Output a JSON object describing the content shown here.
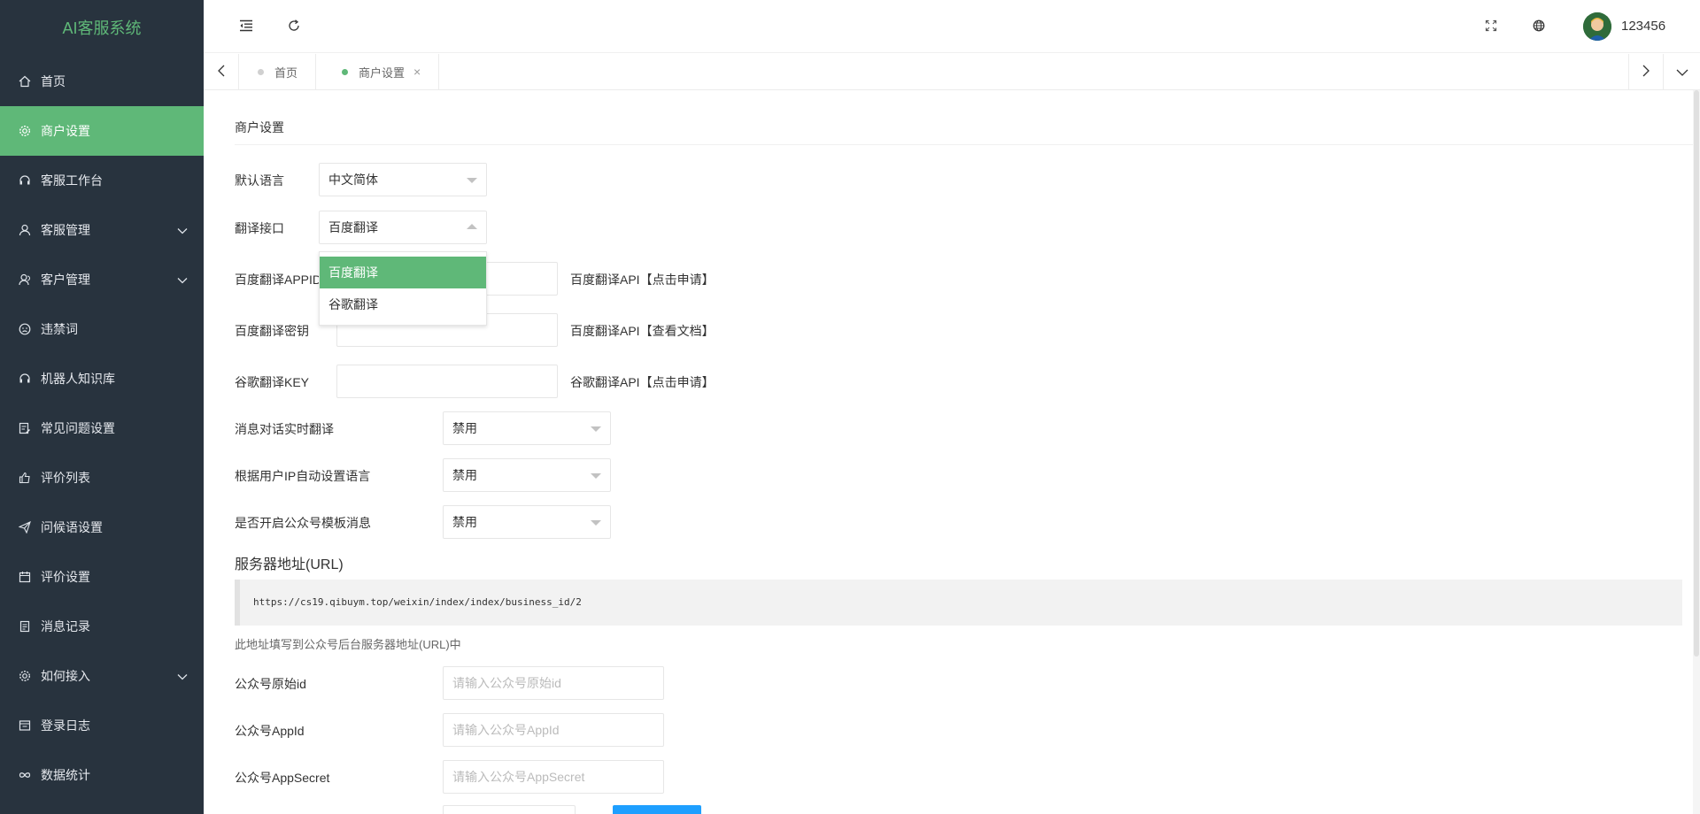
{
  "app": {
    "title": "AI客服系统"
  },
  "sidebar": {
    "items": [
      {
        "label": "首页",
        "icon": "home-icon"
      },
      {
        "label": "商户设置",
        "icon": "gear-icon",
        "active": true
      },
      {
        "label": "客服工作台",
        "icon": "headset-icon"
      },
      {
        "label": "客服管理",
        "icon": "user-icon",
        "expandable": true
      },
      {
        "label": "客户管理",
        "icon": "users-icon",
        "expandable": true
      },
      {
        "label": "违禁词",
        "icon": "face-icon"
      },
      {
        "label": "机器人知识库",
        "icon": "robot-icon"
      },
      {
        "label": "常见问题设置",
        "icon": "edit-doc-icon"
      },
      {
        "label": "评价列表",
        "icon": "thumb-up-icon"
      },
      {
        "label": "问候语设置",
        "icon": "send-icon"
      },
      {
        "label": "评价设置",
        "icon": "calendar-icon"
      },
      {
        "label": "消息记录",
        "icon": "doc-icon"
      },
      {
        "label": "如何接入",
        "icon": "settings-icon",
        "expandable": true
      },
      {
        "label": "登录日志",
        "icon": "log-icon"
      },
      {
        "label": "数据统计",
        "icon": "infinity-icon"
      }
    ]
  },
  "header": {
    "username": "123456"
  },
  "tabs": [
    {
      "label": "首页",
      "active": false
    },
    {
      "label": "商户设置",
      "active": true,
      "closable": true
    }
  ],
  "form": {
    "card_title": "商户设置",
    "default_language": {
      "label": "默认语言",
      "value": "中文简体"
    },
    "translate_api": {
      "label": "翻译接口",
      "value": "百度翻译",
      "options": [
        "百度翻译",
        "谷歌翻译"
      ],
      "open": true
    },
    "baidu_appid": {
      "label": "百度翻译APPID",
      "value": "",
      "link": "百度翻译API【点击申请】"
    },
    "baidu_secret": {
      "label": "百度翻译密钥",
      "value": "",
      "link": "百度翻译API【查看文档】"
    },
    "google_key": {
      "label": "谷歌翻译KEY",
      "value": "",
      "link": "谷歌翻译API【点击申请】"
    },
    "realtime_translate": {
      "label": "消息对话实时翻译",
      "value": "禁用"
    },
    "auto_language_by_ip": {
      "label": "根据用户IP自动设置语言",
      "value": "禁用"
    },
    "wechat_template_msg": {
      "label": "是否开启公众号模板消息",
      "value": "禁用"
    },
    "server_url": {
      "heading": "服务器地址(URL)",
      "value": "https://cs19.qibuym.top/weixin/index/index/business_id/2",
      "hint": "此地址填写到公众号后台服务器地址(URL)中"
    },
    "wechat_original_id": {
      "label": "公众号原始id",
      "placeholder": "请输入公众号原始id"
    },
    "wechat_appid": {
      "label": "公众号AppId",
      "placeholder": "请输入公众号AppId"
    },
    "wechat_appsecret": {
      "label": "公众号AppSecret",
      "placeholder": "请输入公众号AppSecret"
    }
  },
  "colors": {
    "sidebar_bg": "#28333e",
    "accent": "#5fb878",
    "primary_button": "#1e9fff"
  }
}
